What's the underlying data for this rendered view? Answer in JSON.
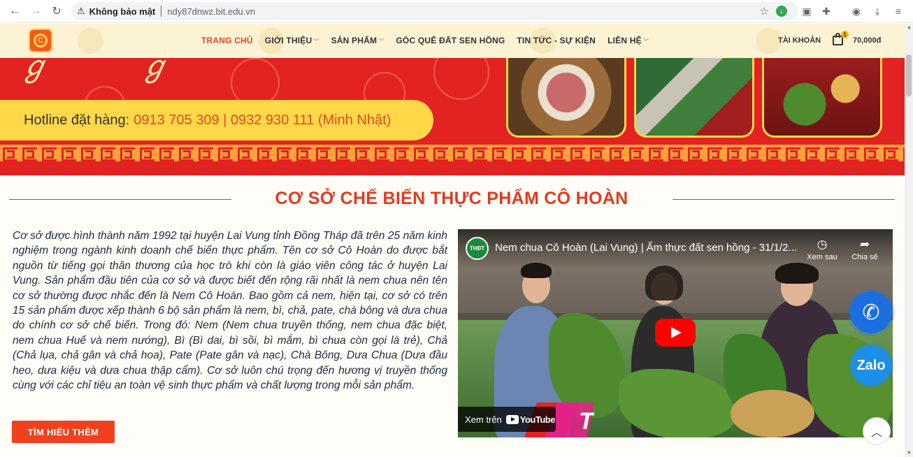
{
  "browser": {
    "security_label": "Không bảo mật",
    "url": "ndy87dnwz.bit.edu.vn"
  },
  "header": {
    "nav": [
      {
        "label": "TRANG CHỦ",
        "active": true,
        "dropdown": false
      },
      {
        "label": "GIỚI THIỆU",
        "active": false,
        "dropdown": true
      },
      {
        "label": "SẢN PHẨM",
        "active": false,
        "dropdown": true
      },
      {
        "label": "GÓC QUÊ ĐẤT SEN HỒNG",
        "active": false,
        "dropdown": false
      },
      {
        "label": "TIN TỨC - SỰ KIỆN",
        "active": false,
        "dropdown": false
      },
      {
        "label": "LIÊN HỆ",
        "active": false,
        "dropdown": true
      }
    ],
    "account_label": "TÀI KHOẢN",
    "cart_count": "1",
    "cart_total": "70,000đ"
  },
  "banner": {
    "hotline_label": "Hotline đặt hàng:",
    "hotline_numbers": "0913 705 309 | 0932 930 111 (Minh Nhật)"
  },
  "section": {
    "title": "CƠ SỞ CHẾ BIẾN THỰC PHẨM CÔ HOÀN",
    "intro": "Cơ sở được hình thành năm 1992 tại huyện Lai Vung tỉnh Đồng Tháp đã trên 25 năm kinh nghiệm trong ngành kinh doanh chế biến thực phẩm. Tên cơ sở Cô Hoàn do được bắt nguồn từ tiếng gọi thân thương của học trò khi còn là giáo viên công tác ở huyện Lai Vung. Sản phẩm đầu tiên của cơ sở và được biết đến rộng rãi nhất là nem chua nên tên cơ sở thường được nhắc đến là Nem Cô Hoàn. Bao gồm cả nem, hiện tại, cơ sở có trên 15 sản phẩm được xếp thành 6 bộ sản phẩm là nem, bì, chả, pate, chà bông và dưa chua do chính cơ sở chế biến. Trong đó: Nem (Nem chua truyền thống, nem chua đặc biệt, nem chua Huế và nem nướng), Bì (Bì dai, bì sồi, bì mắm, bì chua còn gọi là trẻ), Chả (Chả lụa, chả gân và chả hoa), Pate (Pate gân và nạc), Chà Bông, Dưa Chua (Dưa đầu heo, dưa kiệu và dưa chua thập cẩm). Cơ sở luôn chú trọng đến hương vị truyền thống cùng với các chỉ tiêu an toàn vệ sinh thực phẩm và chất lượng trong mỗi sản phẩm.",
    "cta_label": "TÌM HIỂU THÊM"
  },
  "video": {
    "channel_badge": "THĐT",
    "title": "Nem chua Cô Hoàn (Lai Vung) | Ẩm thực đất sen hồng - 31/1/2...",
    "watch_later": "Xem sau",
    "share": "Chia sẻ",
    "watch_on": "Xem trên",
    "youtube": "YouTube"
  },
  "floating": {
    "zalo_label": "Zalo"
  },
  "colors": {
    "accent": "#e33a1e",
    "banner_red": "#e32222",
    "hotline_yellow": "#ffd84a",
    "cta": "#f0401e"
  }
}
